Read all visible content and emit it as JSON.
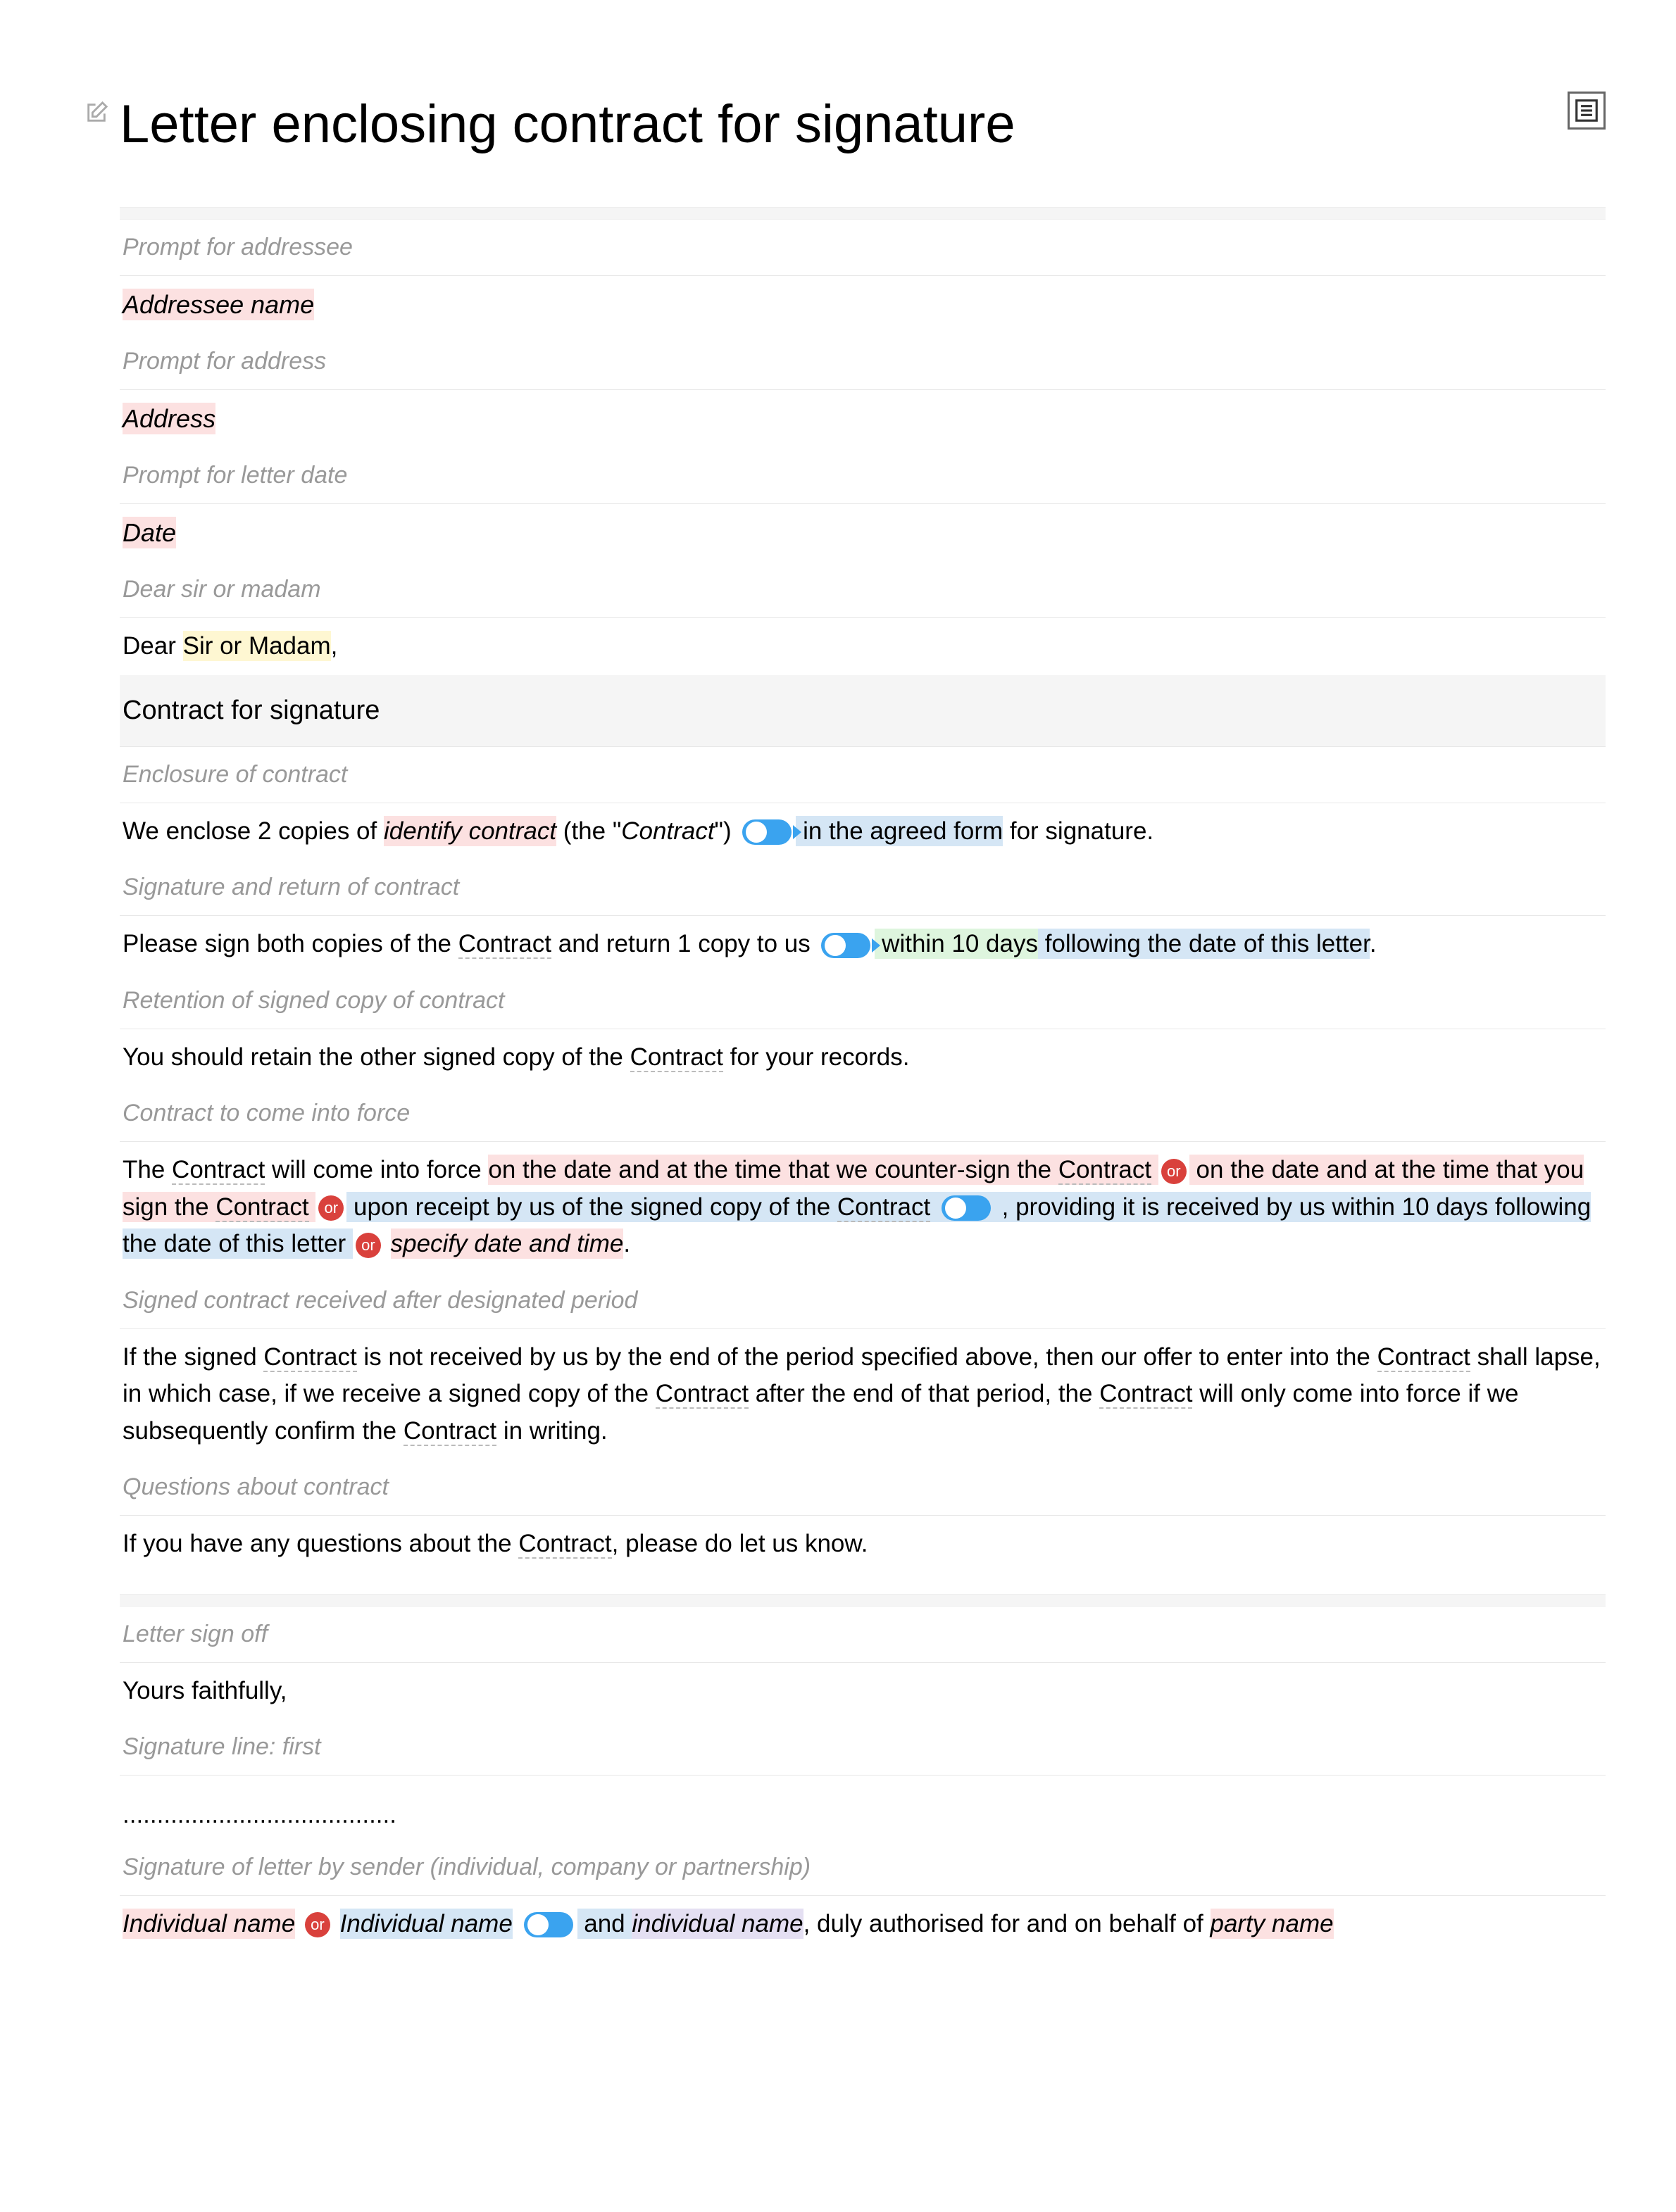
{
  "title": "Letter enclosing contract for signature",
  "labels": {
    "addressee_prompt": "Prompt for addressee",
    "address_prompt": "Prompt for address",
    "date_prompt": "Prompt for letter date",
    "salutation_label": "Dear sir or madam",
    "enclosure": "Enclosure of contract",
    "sig_return": "Signature and return of contract",
    "retention": "Retention of signed copy of contract",
    "come_into_force": "Contract to come into force",
    "after_period": "Signed contract received after designated period",
    "questions": "Questions about contract",
    "sign_off": "Letter sign off",
    "sig_line": "Signature line: first",
    "sender_sig": "Signature of letter by sender (individual, company or partnership)"
  },
  "fields": {
    "addressee_name": "Addressee name",
    "address": "Address",
    "date": "Date"
  },
  "salutation": {
    "dear": "Dear ",
    "sir_or_madam": "Sir or Madam",
    "comma": ","
  },
  "subject": "Contract for signature",
  "enclosure": {
    "t1": "We enclose 2 copies of ",
    "identify": "identify contract",
    "t2": " (the \"",
    "contract_word": "Contract",
    "t3": "\") ",
    "agreed": " in the agreed form",
    "t4": " for signature."
  },
  "sig_return": {
    "t1": "Please sign both copies of the ",
    "contract": "Contract",
    "t2": " and return 1 copy to us ",
    "within": " within 10 days",
    "following": " following the date of this letter",
    "period": "."
  },
  "retention": {
    "t1": "You should retain the other signed copy of the ",
    "contract": "Contract",
    "t2": " for your records."
  },
  "force": {
    "t1": "The ",
    "contract1": "Contract",
    "t2": " will come into force ",
    "opt1a": "on the date and at the time that we counter-sign the ",
    "opt1b": "Contract",
    "opt2a": " on the date and at the time that you sign the ",
    "opt2b": "Contract",
    "opt3a": " upon receipt by us of the signed copy of the ",
    "opt3b": "Contract",
    "opt3c": " , providing it is received by us within 10 days following the date of this letter",
    "opt4": "specify date and time",
    "period": "."
  },
  "after": {
    "t1": "If the signed ",
    "c1": "Contract",
    "t2": " is not received by us by the end of the period specified above, then our offer to enter into the ",
    "c2": "Contract",
    "t3": " shall lapse, in which case, if we receive a signed copy of the ",
    "c3": "Contract",
    "t4": " after the end of that period, the ",
    "c4": "Contract",
    "t5": " will only come into force if we subsequently confirm the ",
    "c5": "Contract",
    "t6": " in writing."
  },
  "questions": {
    "t1": "If you have any questions about the ",
    "c1": "Contract",
    "t2": ", please do let us know."
  },
  "sign_off": "Yours faithfully,",
  "dots": "........................................",
  "sender": {
    "ind1": "Individual name",
    "ind2": "Individual name",
    "and": " and ",
    "ind3": "individual name",
    "t1": ", duly authorised for and on behalf of ",
    "party": "party name"
  },
  "or": "or"
}
